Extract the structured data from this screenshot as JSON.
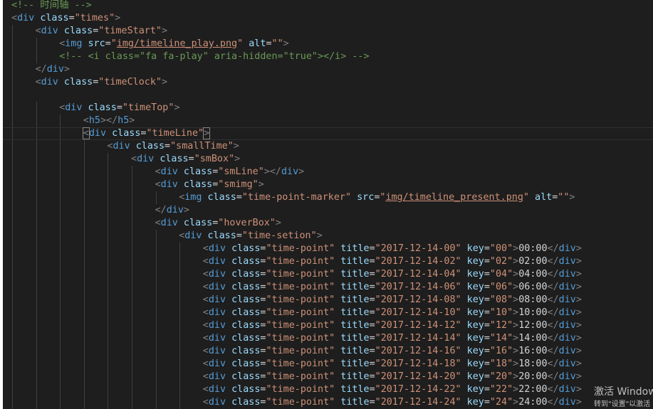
{
  "editor": {
    "lines": [
      {
        "indent": 0,
        "type": "comment",
        "text": "<!-- 时间轴 -->"
      },
      {
        "indent": 0,
        "type": "open",
        "tag": "div",
        "attrs": [
          [
            "class",
            "times"
          ]
        ]
      },
      {
        "indent": 1,
        "type": "open",
        "tag": "div",
        "attrs": [
          [
            "class",
            "timeStart"
          ]
        ]
      },
      {
        "indent": 2,
        "type": "open",
        "tag": "img",
        "attrs": [
          [
            "src",
            "img/timeline_play.png",
            true
          ],
          [
            "alt",
            ""
          ]
        ]
      },
      {
        "indent": 2,
        "type": "comment",
        "text": "<!-- <i class=\"fa fa-play\" aria-hidden=\"true\"></i> -->"
      },
      {
        "indent": 1,
        "type": "close",
        "tag": "div"
      },
      {
        "indent": 1,
        "type": "open",
        "tag": "div",
        "attrs": [
          [
            "class",
            "timeClock"
          ]
        ]
      },
      {
        "indent": 1,
        "type": "blank"
      },
      {
        "indent": 2,
        "type": "open",
        "tag": "div",
        "attrs": [
          [
            "class",
            "timeTop"
          ]
        ]
      },
      {
        "indent": 3,
        "type": "pair",
        "tag": "h5",
        "content": ""
      },
      {
        "indent": 3,
        "type": "open",
        "tag": "div",
        "attrs": [
          [
            "class",
            "timeLine"
          ]
        ],
        "current": true
      },
      {
        "indent": 4,
        "type": "open",
        "tag": "div",
        "attrs": [
          [
            "class",
            "smallTime"
          ]
        ]
      },
      {
        "indent": 5,
        "type": "open",
        "tag": "div",
        "attrs": [
          [
            "class",
            "smBox"
          ]
        ]
      },
      {
        "indent": 6,
        "type": "pair",
        "tag": "div",
        "attrs": [
          [
            "class",
            "smLine"
          ]
        ],
        "content": ""
      },
      {
        "indent": 6,
        "type": "open",
        "tag": "div",
        "attrs": [
          [
            "class",
            "smimg"
          ]
        ]
      },
      {
        "indent": 7,
        "type": "open",
        "tag": "img",
        "attrs": [
          [
            "class",
            "time-point-marker"
          ],
          [
            "src",
            "img/timeline_present.png",
            true
          ],
          [
            "alt",
            ""
          ]
        ]
      },
      {
        "indent": 6,
        "type": "close",
        "tag": "div"
      },
      {
        "indent": 6,
        "type": "open",
        "tag": "div",
        "attrs": [
          [
            "class",
            "hoverBox"
          ]
        ]
      },
      {
        "indent": 7,
        "type": "open",
        "tag": "div",
        "attrs": [
          [
            "class",
            "time-setion"
          ]
        ]
      },
      {
        "indent": 8,
        "type": "pair",
        "tag": "div",
        "attrs": [
          [
            "class",
            "time-point"
          ],
          [
            "title",
            "2017-12-14-00"
          ],
          [
            "key",
            "00"
          ]
        ],
        "content": "00:00"
      },
      {
        "indent": 8,
        "type": "pair",
        "tag": "div",
        "attrs": [
          [
            "class",
            "time-point"
          ],
          [
            "title",
            "2017-12-14-02"
          ],
          [
            "key",
            "02"
          ]
        ],
        "content": "02:00"
      },
      {
        "indent": 8,
        "type": "pair",
        "tag": "div",
        "attrs": [
          [
            "class",
            "time-point"
          ],
          [
            "title",
            "2017-12-14-04"
          ],
          [
            "key",
            "04"
          ]
        ],
        "content": "04:00"
      },
      {
        "indent": 8,
        "type": "pair",
        "tag": "div",
        "attrs": [
          [
            "class",
            "time-point"
          ],
          [
            "title",
            "2017-12-14-06"
          ],
          [
            "key",
            "06"
          ]
        ],
        "content": "06:00"
      },
      {
        "indent": 8,
        "type": "pair",
        "tag": "div",
        "attrs": [
          [
            "class",
            "time-point"
          ],
          [
            "title",
            "2017-12-14-08"
          ],
          [
            "key",
            "08"
          ]
        ],
        "content": "08:00"
      },
      {
        "indent": 8,
        "type": "pair",
        "tag": "div",
        "attrs": [
          [
            "class",
            "time-point"
          ],
          [
            "title",
            "2017-12-14-10"
          ],
          [
            "key",
            "10"
          ]
        ],
        "content": "10:00"
      },
      {
        "indent": 8,
        "type": "pair",
        "tag": "div",
        "attrs": [
          [
            "class",
            "time-point"
          ],
          [
            "title",
            "2017-12-14-12"
          ],
          [
            "key",
            "12"
          ]
        ],
        "content": "12:00"
      },
      {
        "indent": 8,
        "type": "pair",
        "tag": "div",
        "attrs": [
          [
            "class",
            "time-point"
          ],
          [
            "title",
            "2017-12-14-14"
          ],
          [
            "key",
            "14"
          ]
        ],
        "content": "14:00"
      },
      {
        "indent": 8,
        "type": "pair",
        "tag": "div",
        "attrs": [
          [
            "class",
            "time-point"
          ],
          [
            "title",
            "2017-12-14-16"
          ],
          [
            "key",
            "16"
          ]
        ],
        "content": "16:00"
      },
      {
        "indent": 8,
        "type": "pair",
        "tag": "div",
        "attrs": [
          [
            "class",
            "time-point"
          ],
          [
            "title",
            "2017-12-14-18"
          ],
          [
            "key",
            "18"
          ]
        ],
        "content": "18:00"
      },
      {
        "indent": 8,
        "type": "pair",
        "tag": "div",
        "attrs": [
          [
            "class",
            "time-point"
          ],
          [
            "title",
            "2017-12-14-20"
          ],
          [
            "key",
            "20"
          ]
        ],
        "content": "20:00"
      },
      {
        "indent": 8,
        "type": "pair",
        "tag": "div",
        "attrs": [
          [
            "class",
            "time-point"
          ],
          [
            "title",
            "2017-12-14-22"
          ],
          [
            "key",
            "22"
          ]
        ],
        "content": "22:00"
      },
      {
        "indent": 8,
        "type": "pair",
        "tag": "div",
        "attrs": [
          [
            "class",
            "time-point"
          ],
          [
            "title",
            "2017-12-14-24"
          ],
          [
            "key",
            "24"
          ]
        ],
        "content": "24:00"
      }
    ]
  },
  "watermark": {
    "line1": "激活 Windows",
    "line2": "转到\"设置\"以激活 Windows。"
  },
  "colors": {
    "background": "#1e1e1e",
    "tag": "#569cd6",
    "attribute": "#9cdcfe",
    "string": "#ce9178",
    "punctuation": "#808080",
    "comment": "#6a9955",
    "text": "#d4d4d4"
  }
}
